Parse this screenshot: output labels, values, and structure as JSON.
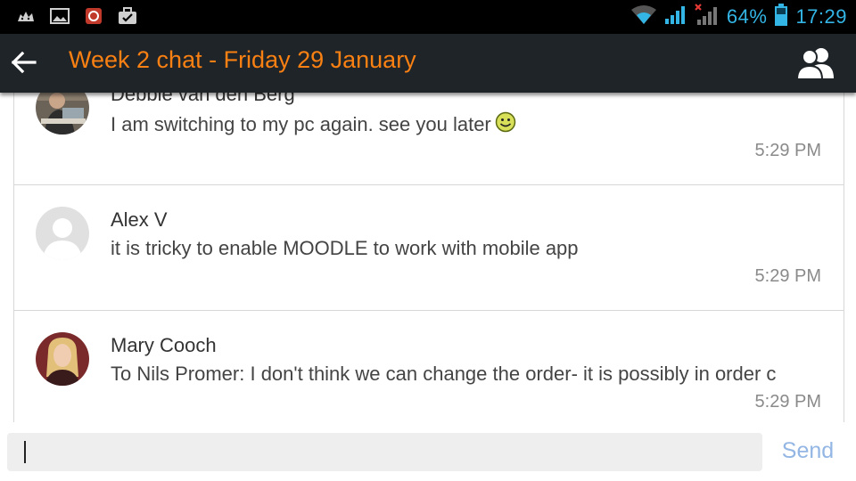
{
  "status_bar": {
    "battery_percent": "64%",
    "time": "17:29",
    "left_icons": [
      "cat-notification-icon",
      "image-icon",
      "app-notification-icon",
      "briefcase-check-icon"
    ],
    "right_icons": [
      "wifi-icon",
      "signal-icon",
      "no-signal-icon",
      "battery-icon"
    ]
  },
  "header": {
    "title": "Week 2 chat - Friday 29 January",
    "title_color": "#f98012",
    "back_icon": "arrow-left-icon",
    "participants_icon": "participants-icon"
  },
  "messages": [
    {
      "author": "Debbie van den Berg",
      "text": "I am switching to my pc again. see you later",
      "emoticon": "smiley-icon",
      "time": "5:29 PM",
      "avatar": "photo"
    },
    {
      "author": "Alex V",
      "text": "it is tricky to enable MOODLE to work with mobile app",
      "time": "5:29 PM",
      "avatar": "default-user"
    },
    {
      "author": "Mary Cooch",
      "text": "To Nils Promer: I don't think we can change the order- it is possibly in order c",
      "time": "5:29 PM",
      "avatar": "photo"
    }
  ],
  "composer": {
    "input_value": "",
    "send_label": "Send"
  }
}
